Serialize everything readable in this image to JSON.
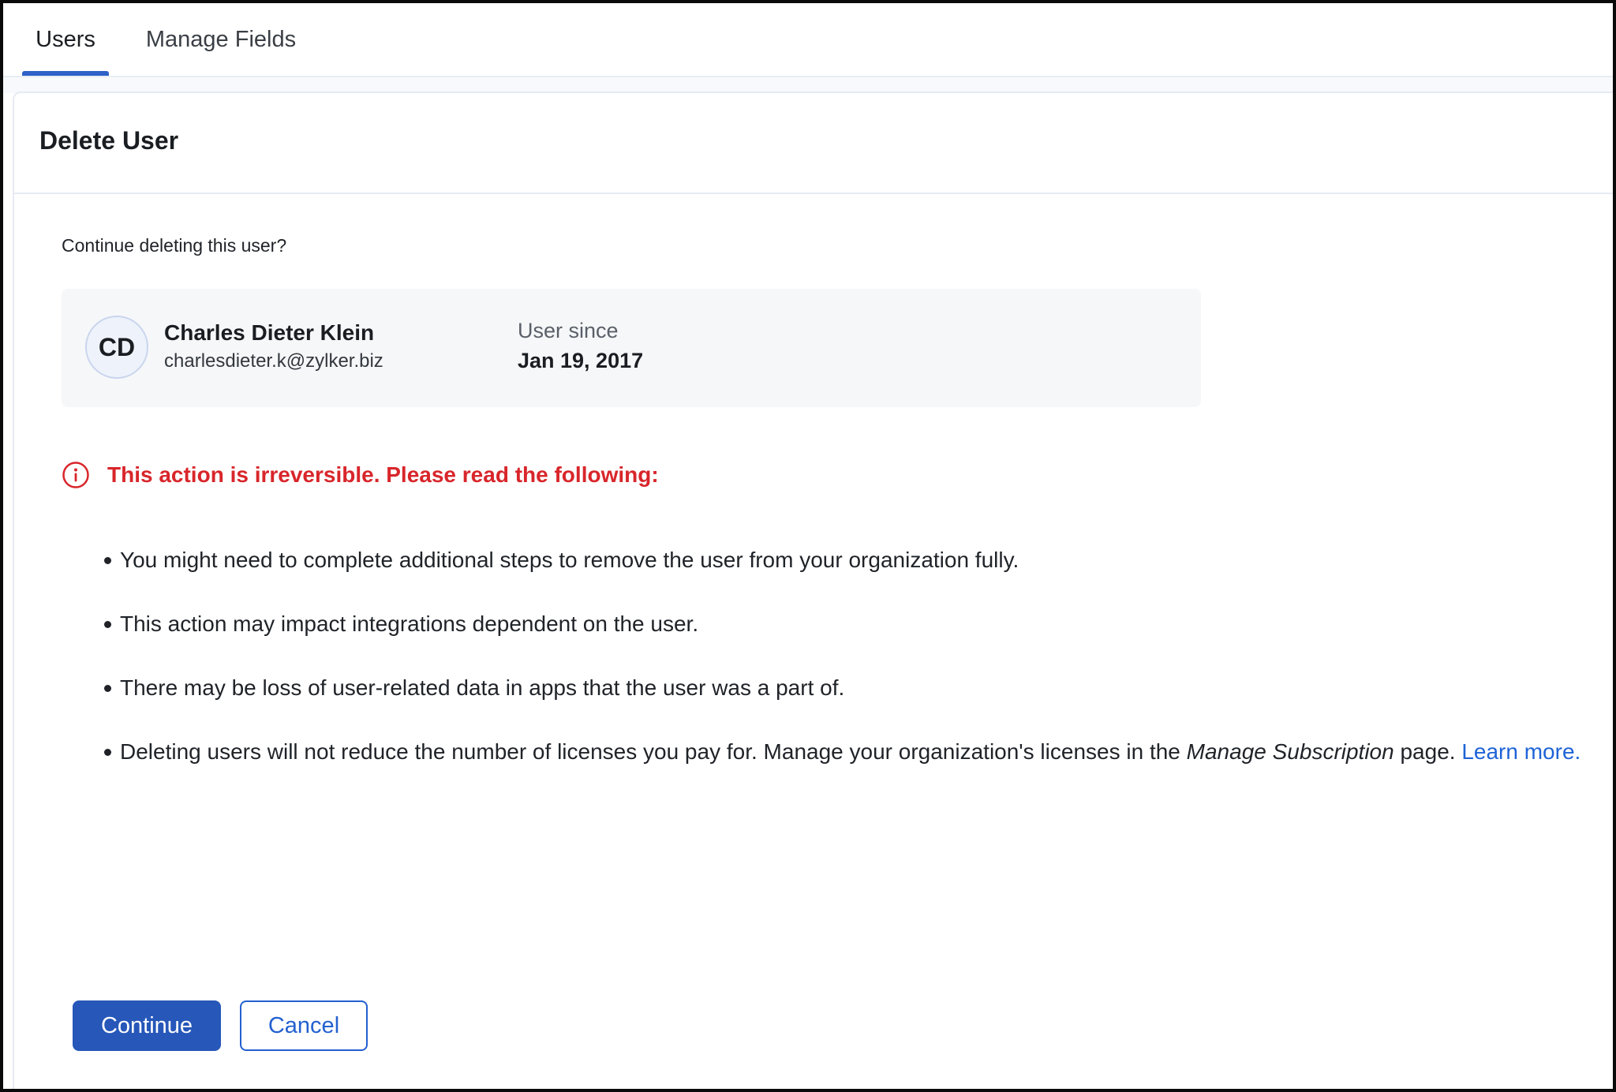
{
  "tabs": {
    "users": "Users",
    "manage_fields": "Manage Fields"
  },
  "panel": {
    "title": "Delete User",
    "question": "Continue deleting this user?"
  },
  "user": {
    "initials": "CD",
    "name": "Charles Dieter Klein",
    "email": "charlesdieter.k@zylker.biz",
    "since_label": "User since",
    "since_date": "Jan 19, 2017"
  },
  "warning": {
    "icon": "info-icon",
    "text": "This action is irreversible. Please read the following:"
  },
  "bullets": {
    "b1": "You might need to complete additional steps to remove the user from your organization fully.",
    "b2": "This action may impact integrations dependent on the user.",
    "b3": "There may be loss of user-related data in apps that the user was a part of.",
    "b4_pre": "Deleting users will not reduce the number of licenses you pay for. Manage your organization's licenses in the ",
    "b4_em": "Manage Subscription",
    "b4_post": " page. ",
    "b4_link": "Learn more."
  },
  "buttons": {
    "continue": "Continue",
    "cancel": "Cancel"
  },
  "colors": {
    "accent": "#2657b9",
    "active_tab_underline": "#2e62c8",
    "warning": "#d8262b",
    "link": "#1e63d6"
  }
}
